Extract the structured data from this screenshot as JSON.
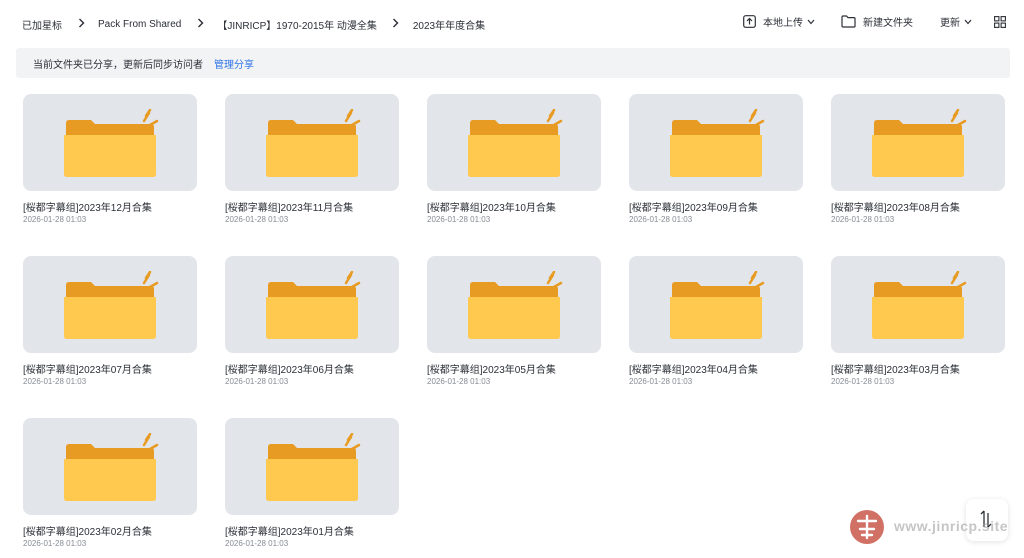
{
  "breadcrumb": {
    "items": [
      "已加星标",
      "Pack From Shared",
      "【JINRICP】1970-2015年 动漫全集",
      "2023年年度合集"
    ]
  },
  "toolbar": {
    "upload_label": "本地上传",
    "new_folder_label": "新建文件夹",
    "sort_label": "更新"
  },
  "share_banner": {
    "text": "当前文件夹已分享，更新后同步访问者",
    "link": "管理分享"
  },
  "folders": [
    {
      "name": "[桜都字幕组]2023年12月合集",
      "date": "2026-01-28 01:03"
    },
    {
      "name": "[桜都字幕组]2023年11月合集",
      "date": "2026-01-28 01:03"
    },
    {
      "name": "[桜都字幕组]2023年10月合集",
      "date": "2026-01-28 01:03"
    },
    {
      "name": "[桜都字幕组]2023年09月合集",
      "date": "2026-01-28 01:03"
    },
    {
      "name": "[桜都字幕组]2023年08月合集",
      "date": "2026-01-28 01:03"
    },
    {
      "name": "[桜都字幕组]2023年07月合集",
      "date": "2026-01-28 01:03"
    },
    {
      "name": "[桜都字幕组]2023年06月合集",
      "date": "2026-01-28 01:03"
    },
    {
      "name": "[桜都字幕组]2023年05月合集",
      "date": "2026-01-28 01:03"
    },
    {
      "name": "[桜都字幕组]2023年04月合集",
      "date": "2026-01-28 01:03"
    },
    {
      "name": "[桜都字幕组]2023年03月合集",
      "date": "2026-01-28 01:03"
    },
    {
      "name": "[桜都字幕组]2023年02月合集",
      "date": "2026-01-28 01:03"
    },
    {
      "name": "[桜都字幕组]2023年01月合集",
      "date": "2026-01-28 01:03"
    }
  ],
  "icons": {
    "folder": "folder-icon",
    "upload": "upload-icon",
    "new_folder": "folder-outline-icon",
    "grid_view": "grid-view-icon",
    "scroll": "sort-arrows-icon",
    "watermark_logo": "jinricp-logo"
  },
  "colors": {
    "folder_front": "#FFC84E",
    "folder_back": "#E89B23",
    "thumb_bg": "#E2E5EA",
    "link": "#2F74E5"
  },
  "watermark": {
    "text": "www.jinricp.site"
  }
}
